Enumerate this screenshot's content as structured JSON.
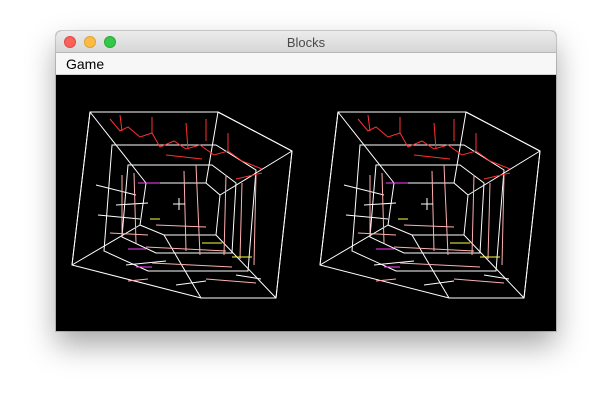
{
  "window": {
    "title": "Blocks"
  },
  "menu": {
    "items": [
      "Game"
    ]
  },
  "scene": {
    "description_icons": [
      "wireframe-cube-left",
      "wireframe-cube-right",
      "crosshair-icon"
    ],
    "colors": {
      "frame": "#ffffff",
      "inner_red": "#ff3030",
      "inner_pink": "#ffb0b0",
      "inner_magenta": "#ff40ff",
      "inner_yellow": "#ffff40",
      "background": "#000000"
    }
  }
}
